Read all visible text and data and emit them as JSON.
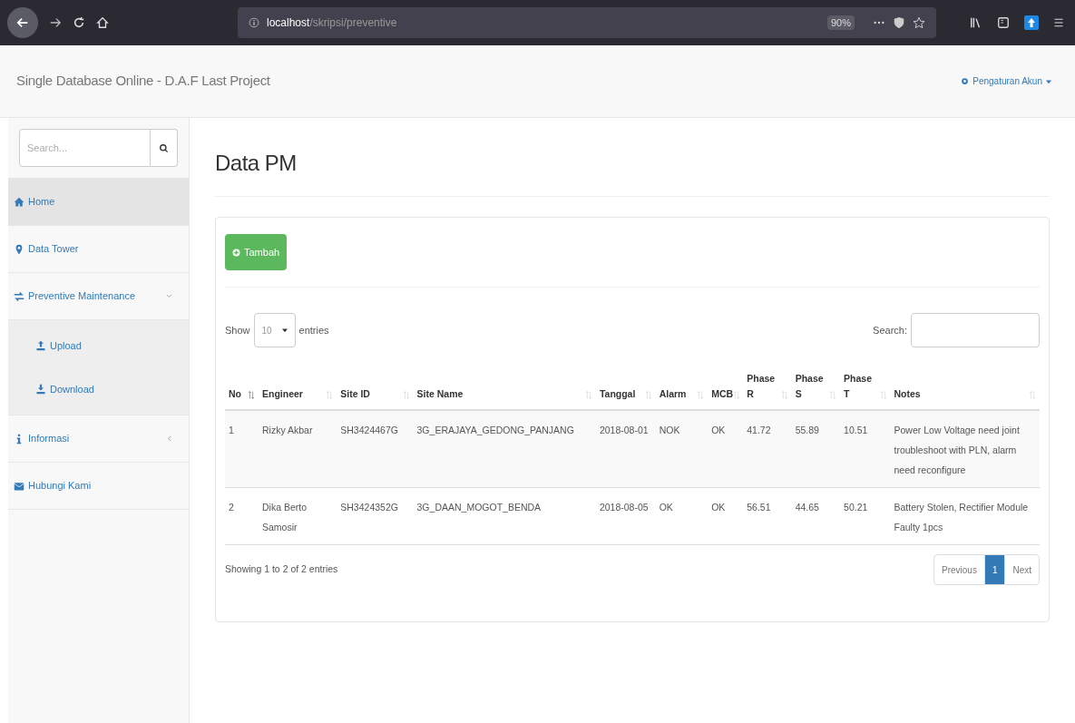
{
  "browser": {
    "url_host": "localhost",
    "url_path": "/skripsi/preventive",
    "zoom": "90%"
  },
  "navbar": {
    "brand": "Single Database Online - D.A.F Last Project",
    "account": "Pengaturan Akun"
  },
  "sidebar": {
    "search_placeholder": "Search...",
    "items": [
      {
        "label": "Home",
        "selected": true
      },
      {
        "label": "Data Tower",
        "selected": false
      },
      {
        "label": "Preventive Maintenance",
        "selected": false,
        "expanded": true,
        "children": [
          {
            "label": "Upload"
          },
          {
            "label": "Download"
          }
        ]
      },
      {
        "label": "Informasi",
        "selected": false,
        "expanded": false
      },
      {
        "label": "Hubungi Kami",
        "selected": false
      }
    ]
  },
  "page_title": "Data PM",
  "add_button": "Tambah",
  "length": {
    "before": "Show",
    "value": "10",
    "after": "entries"
  },
  "search_label": "Search:",
  "table": {
    "columns": [
      {
        "lines": [
          "No"
        ],
        "sorted": true
      },
      {
        "lines": [
          "Engineer"
        ],
        "sorted": false
      },
      {
        "lines": [
          "Site ID"
        ],
        "sorted": false
      },
      {
        "lines": [
          "Site Name"
        ],
        "sorted": false
      },
      {
        "lines": [
          "Tanggal"
        ],
        "sorted": false
      },
      {
        "lines": [
          "Alarm"
        ],
        "sorted": false
      },
      {
        "lines": [
          "MCB"
        ],
        "sorted": false
      },
      {
        "lines": [
          "Phase",
          "R"
        ],
        "sorted": false
      },
      {
        "lines": [
          "Phase",
          "S"
        ],
        "sorted": false
      },
      {
        "lines": [
          "Phase",
          "T"
        ],
        "sorted": false
      },
      {
        "lines": [
          "Notes"
        ],
        "sorted": false
      }
    ],
    "rows": [
      [
        "1",
        "Rizky Akbar",
        "SH3424467G",
        "3G_ERAJAYA_GEDONG_PANJANG",
        "2018-08-01",
        "NOK",
        "OK",
        "41.72",
        "55.89",
        "10.51",
        "Power Low Voltage need joint troubleshoot with PLN, alarm need reconfigure"
      ],
      [
        "2",
        "Dika Berto Samosir",
        "SH3424352G",
        "3G_DAAN_MOGOT_BENDA",
        "2018-08-05",
        "OK",
        "OK",
        "56.51",
        "44.65",
        "50.21",
        "Battery Stolen, Rectifier Module Faulty 1pcs"
      ]
    ]
  },
  "info": "Showing 1 to 2 of 2 entries",
  "pagination": [
    {
      "label": "Previous",
      "selected": false
    },
    {
      "label": "1",
      "selected": true
    },
    {
      "label": "Next",
      "selected": false
    }
  ]
}
